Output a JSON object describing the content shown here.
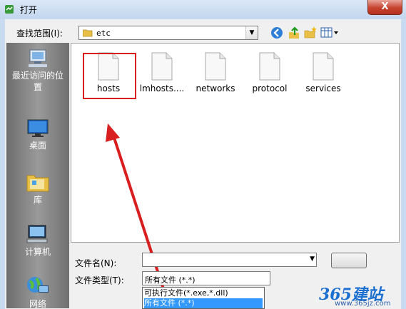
{
  "window": {
    "title": "打开",
    "close_label": "X"
  },
  "lookin": {
    "label": "查找范围(I):",
    "value": "etc"
  },
  "places": [
    {
      "label_line1": "最近访问的位",
      "label_line2": "置",
      "icon": "recent-places-icon"
    },
    {
      "label_line1": "桌面",
      "label_line2": "",
      "icon": "desktop-icon"
    },
    {
      "label_line1": "库",
      "label_line2": "",
      "icon": "libraries-icon"
    },
    {
      "label_line1": "计算机",
      "label_line2": "",
      "icon": "computer-icon"
    },
    {
      "label_line1": "网络",
      "label_line2": "",
      "icon": "network-icon"
    }
  ],
  "files": [
    {
      "name": "hosts"
    },
    {
      "name": "lmhosts...."
    },
    {
      "name": "networks"
    },
    {
      "name": "protocol"
    },
    {
      "name": "services"
    }
  ],
  "filename": {
    "label": "文件名(N):",
    "value": ""
  },
  "filetype": {
    "label": "文件类型(T):",
    "value": "所有文件 (*.*)",
    "options": [
      "可执行文件(*.exe,*.dll)",
      "所有文件 (*.*)"
    ],
    "selected_index": 1
  },
  "watermark": {
    "logo": "365建站",
    "url": "www.365jz.com"
  },
  "colors": {
    "highlight": "#d81e1e",
    "selection": "#3399ff",
    "places_bg": "#808080"
  }
}
